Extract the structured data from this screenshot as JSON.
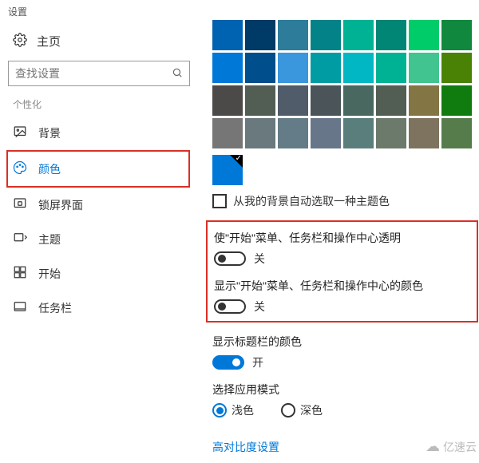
{
  "header": {
    "title": "设置"
  },
  "sidebar": {
    "home": "主页",
    "search_placeholder": "查找设置",
    "section": "个性化",
    "items": [
      {
        "label": "背景"
      },
      {
        "label": "颜色"
      },
      {
        "label": "锁屏界面"
      },
      {
        "label": "主题"
      },
      {
        "label": "开始"
      },
      {
        "label": "任务栏"
      }
    ]
  },
  "palette": {
    "colors": [
      "#0063b1",
      "#003a66",
      "#2d7d9a",
      "#038387",
      "#00b294",
      "#018574",
      "#00cc6a",
      "#10893e",
      "#0078d7",
      "#004e8c",
      "#3a96dd",
      "#009ca4",
      "#00b7c3",
      "#00b294",
      "#41c48f",
      "#498205",
      "#4c4a48",
      "#525e54",
      "#515c6b",
      "#4a5459",
      "#486860",
      "#525e54",
      "#847545",
      "#107c10",
      "#767676",
      "#69797e",
      "#647c87",
      "#68768a",
      "#5a7e7c",
      "#6b7a6a",
      "#7e735f",
      "#567c4c"
    ],
    "selected": "#0078d7"
  },
  "auto_pick": {
    "label": "从我的背景自动选取一种主题色"
  },
  "toggles": {
    "transparent": {
      "title": "使\"开始\"菜单、任务栏和操作中心透明",
      "state": "关"
    },
    "show_color": {
      "title": "显示\"开始\"菜单、任务栏和操作中心的颜色",
      "state": "关"
    },
    "titlebar": {
      "title": "显示标题栏的颜色",
      "state": "开"
    }
  },
  "app_mode": {
    "title": "选择应用模式",
    "options": {
      "light": "浅色",
      "dark": "深色"
    }
  },
  "link": {
    "high_contrast": "高对比度设置"
  },
  "watermark": "亿速云"
}
